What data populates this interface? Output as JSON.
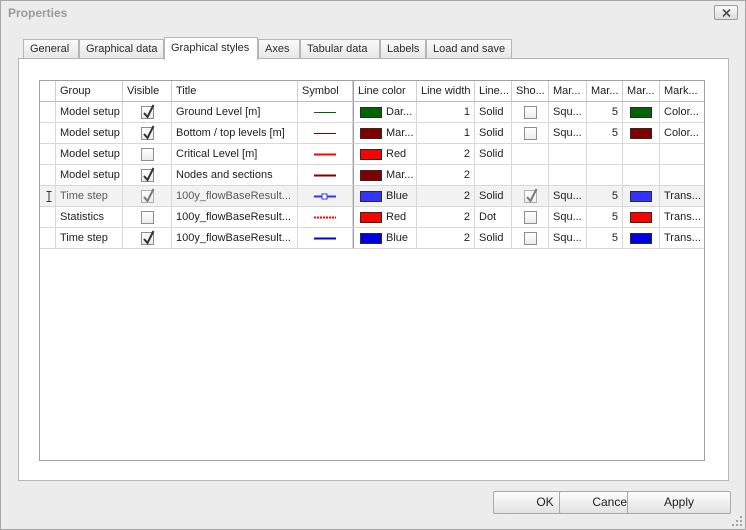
{
  "window": {
    "title": "Properties"
  },
  "tabs": [
    {
      "label": "General"
    },
    {
      "label": "Graphical data"
    },
    {
      "label": "Graphical styles"
    },
    {
      "label": "Axes"
    },
    {
      "label": "Tabular data"
    },
    {
      "label": "Labels"
    },
    {
      "label": "Load and save"
    }
  ],
  "active_tab": "Graphical styles",
  "grid": {
    "columns": [
      {
        "label": "Group"
      },
      {
        "label": "Visible"
      },
      {
        "label": "Title"
      },
      {
        "label": "Symbol"
      },
      {
        "label": "Line color"
      },
      {
        "label": "Line width"
      },
      {
        "label": "Line..."
      },
      {
        "label": "Sho..."
      },
      {
        "label": "Mar..."
      },
      {
        "label": "Mar..."
      },
      {
        "label": "Mar..."
      },
      {
        "label": "Mark..."
      }
    ],
    "rows": [
      {
        "group": "Model setup",
        "visible": true,
        "title": "Ground Level [m]",
        "symbol": "solid-thin",
        "line_color": "#006400",
        "line_color_name": "Dar...",
        "line_width": "1",
        "line_style": "Solid",
        "show_marker": false,
        "marker_style": "Squ...",
        "marker_size": "5",
        "marker_color": "#006400",
        "marker_extra": "Color..."
      },
      {
        "group": "Model setup",
        "visible": true,
        "title": "Bottom / top levels [m]",
        "symbol": "solid-thin",
        "line_color": "#800000",
        "line_color_name": "Mar...",
        "line_width": "1",
        "line_style": "Solid",
        "show_marker": false,
        "marker_style": "Squ...",
        "marker_size": "5",
        "marker_color": "#800000",
        "marker_extra": "Color..."
      },
      {
        "group": "Model setup",
        "visible": false,
        "title": "Critical Level [m]",
        "symbol": "solid",
        "line_color": "#ff0000",
        "line_color_name": "Red",
        "line_width": "2",
        "line_style": "Solid",
        "show_marker": null,
        "marker_style": "",
        "marker_size": "",
        "marker_color": "",
        "marker_extra": ""
      },
      {
        "group": "Model setup",
        "visible": true,
        "title": "Nodes and sections",
        "symbol": "solid",
        "line_color": "#800000",
        "line_color_name": "Mar...",
        "line_width": "2",
        "line_style": "",
        "show_marker": null,
        "marker_style": "",
        "marker_size": "",
        "marker_color": "",
        "marker_extra": ""
      },
      {
        "group": "Time step",
        "visible": true,
        "title": "100y_flowBaseResult...",
        "symbol": "solid-marker",
        "line_color": "#3333ff",
        "line_color_name": "Blue",
        "line_width": "2",
        "line_style": "Solid",
        "show_marker": true,
        "marker_style": "Squ...",
        "marker_size": "5",
        "marker_color": "#3333ff",
        "marker_extra": "Trans...",
        "selected": true
      },
      {
        "group": "Statistics",
        "visible": false,
        "title": "100y_flowBaseResult...",
        "symbol": "dotted",
        "line_color": "#ff0000",
        "line_color_name": "Red",
        "line_width": "2",
        "line_style": "Dot",
        "show_marker": false,
        "marker_style": "Squ...",
        "marker_size": "5",
        "marker_color": "#ff0000",
        "marker_extra": "Trans..."
      },
      {
        "group": "Time step",
        "visible": true,
        "title": "100y_flowBaseResult...",
        "symbol": "solid",
        "line_color": "#0000e6",
        "line_color_name": "Blue",
        "line_width": "2",
        "line_style": "Solid",
        "show_marker": false,
        "marker_style": "Squ...",
        "marker_size": "5",
        "marker_color": "#0000e6",
        "marker_extra": "Trans..."
      }
    ]
  },
  "buttons": {
    "ok": "OK",
    "cancel": "Cancel",
    "apply": "Apply"
  }
}
